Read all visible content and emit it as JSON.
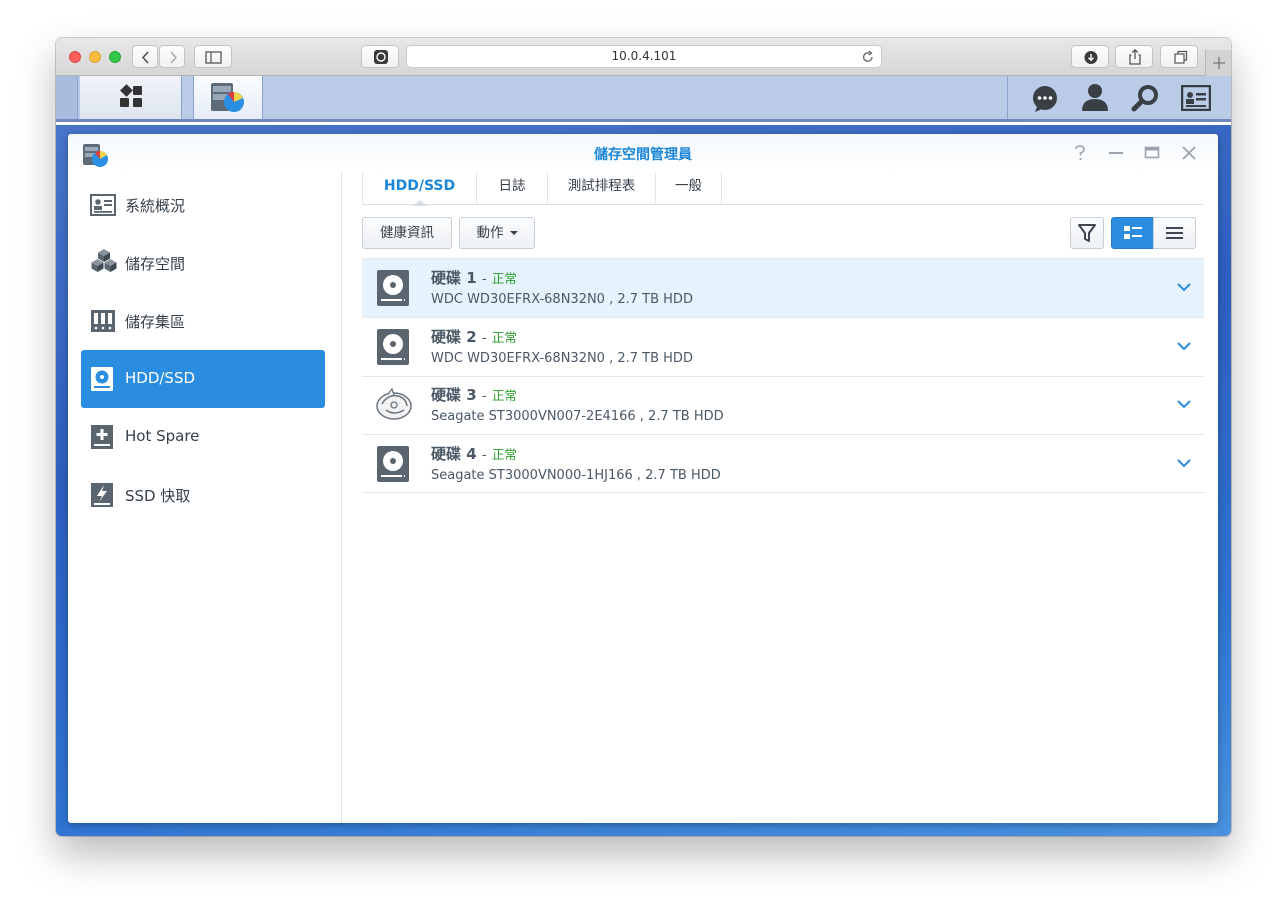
{
  "browser": {
    "url": "10.0.4.101"
  },
  "app": {
    "title": "儲存空間管理員"
  },
  "sidebar": {
    "items": [
      {
        "label": "系統概況",
        "icon": "overview-icon"
      },
      {
        "label": "儲存空間",
        "icon": "storage-cubes-icon"
      },
      {
        "label": "儲存集區",
        "icon": "storage-pool-icon"
      },
      {
        "label": "HDD/SSD",
        "icon": "hdd-icon",
        "active": true
      },
      {
        "label": "Hot Spare",
        "icon": "hot-spare-icon"
      },
      {
        "label": "SSD 快取",
        "icon": "ssd-cache-icon"
      }
    ]
  },
  "tabs": [
    "HDD/SSD",
    "日誌",
    "測試排程表",
    "一般"
  ],
  "toolbar": {
    "health_label": "健康資訊",
    "action_label": "動作"
  },
  "disks": [
    {
      "name": "硬碟 1",
      "dash": "-",
      "status": "正常",
      "model": "WDC WD30EFRX-68N32N0 , 2.7 TB HDD",
      "icon": "hdd-disk-icon"
    },
    {
      "name": "硬碟 2",
      "dash": "-",
      "status": "正常",
      "model": "WDC WD30EFRX-68N32N0 , 2.7 TB HDD",
      "icon": "hdd-disk-icon"
    },
    {
      "name": "硬碟 3",
      "dash": "-",
      "status": "正常",
      "model": "Seagate ST3000VN007-2E4166 , 2.7 TB HDD",
      "icon": "seagate-disk-icon"
    },
    {
      "name": "硬碟 4",
      "dash": "-",
      "status": "正常",
      "model": "Seagate ST3000VN000-1HJ166 , 2.7 TB HDD",
      "icon": "hdd-disk-icon"
    }
  ],
  "colors": {
    "accent": "#2b8de0",
    "status_ok": "#2c9c2c",
    "selected_row": "#e6f2fc"
  }
}
